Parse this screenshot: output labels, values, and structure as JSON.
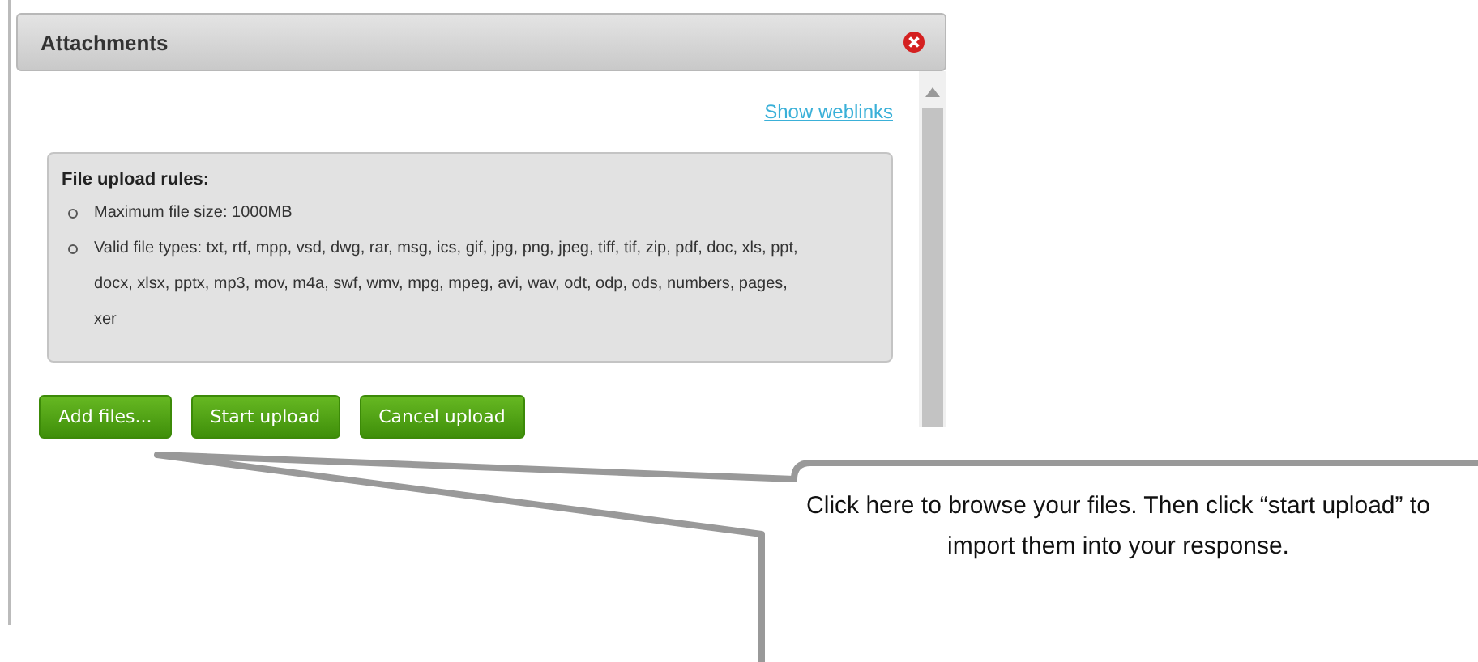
{
  "dialog": {
    "title": "Attachments",
    "link": "Show weblinks",
    "rules": {
      "heading": "File upload rules:",
      "items": [
        "Maximum file size: 1000MB",
        "Valid file types: txt, rtf, mpp, vsd, dwg, rar, msg, ics, gif, jpg, png, jpeg, tiff, tif, zip, pdf, doc, xls, ppt, docx, xlsx, pptx, mp3, mov, m4a, swf, wmv, mpg, mpeg, avi, wav, odt, odp, ods, numbers, pages, xer"
      ]
    },
    "buttons": [
      "Add files...",
      "Start upload",
      "Cancel upload"
    ]
  },
  "callout": {
    "text": "Click here to browse your files. Then click “start upload” to import them into your response."
  }
}
